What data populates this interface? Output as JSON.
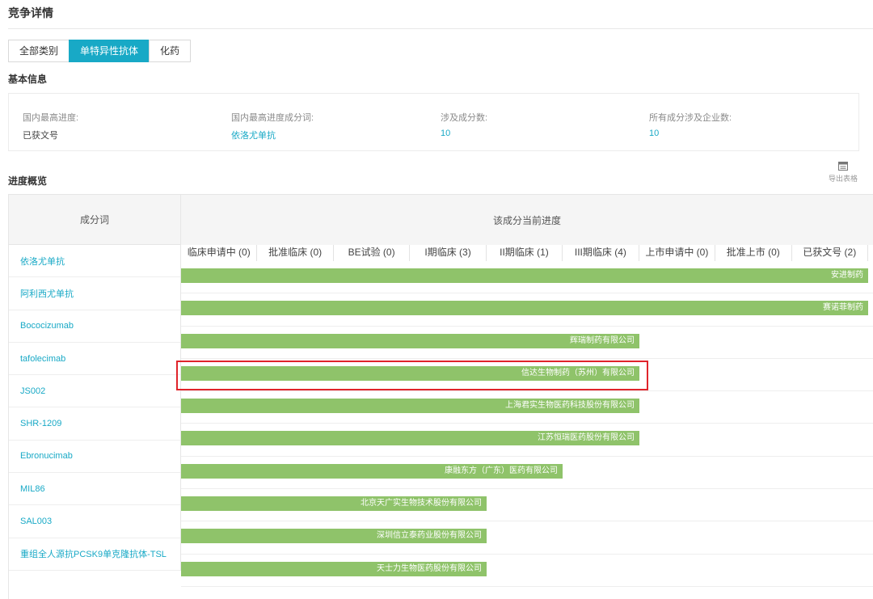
{
  "page": {
    "title": "竞争详情"
  },
  "tabs": [
    {
      "label": "全部类别",
      "active": false
    },
    {
      "label": "单特异性抗体",
      "active": true
    },
    {
      "label": "化药",
      "active": false
    }
  ],
  "basic_info": {
    "heading": "基本信息",
    "items": [
      {
        "label": "国内最高进度:",
        "value": "已获文号",
        "link": false
      },
      {
        "label": "国内最高进度成分词:",
        "value": "依洛尤单抗",
        "link": true
      },
      {
        "label": "涉及成分数:",
        "value": "10",
        "link": true
      },
      {
        "label": "所有成分涉及企业数:",
        "value": "10",
        "link": true
      }
    ]
  },
  "progress": {
    "heading": "进度概览",
    "export_label": "导出表格",
    "export_icon": "table-export-icon",
    "col_ingredient": "成分词",
    "col_progress": "该成分当前进度",
    "stages": [
      "临床申请中 (0)",
      "批准临床 (0)",
      "BE试验 (0)",
      "I期临床 (3)",
      "II期临床 (1)",
      "III期临床 (4)",
      "上市申请中 (0)",
      "批准上市 (0)",
      "已获文号 (2)"
    ],
    "rows": [
      {
        "name": "依洛尤单抗",
        "company": "安进制药",
        "stage_index": 8
      },
      {
        "name": "阿利西尤单抗",
        "company": "赛诺菲制药",
        "stage_index": 8
      },
      {
        "name": "Bococizumab",
        "company": "辉瑞制药有限公司",
        "stage_index": 5
      },
      {
        "name": "tafolecimab",
        "company": "信达生物制药（苏州）有限公司",
        "stage_index": 5
      },
      {
        "name": "JS002",
        "company": "上海君实生物医药科技股份有限公司",
        "stage_index": 5
      },
      {
        "name": "SHR-1209",
        "company": "江苏恒瑞医药股份有限公司",
        "stage_index": 5
      },
      {
        "name": "Ebronucimab",
        "company": "康融东方（广东）医药有限公司",
        "stage_index": 4
      },
      {
        "name": "MIL86",
        "company": "北京天广实生物技术股份有限公司",
        "stage_index": 3
      },
      {
        "name": "SAL003",
        "company": "深圳信立泰药业股份有限公司",
        "stage_index": 3
      },
      {
        "name": "重组全人源抗PCSK9单克隆抗体-TSL",
        "company": "天士力生物医药股份有限公司",
        "stage_index": 3
      }
    ]
  },
  "colors": {
    "accent": "#18a9c6",
    "bar": "#8fc36a",
    "highlight": "#e0242b"
  }
}
